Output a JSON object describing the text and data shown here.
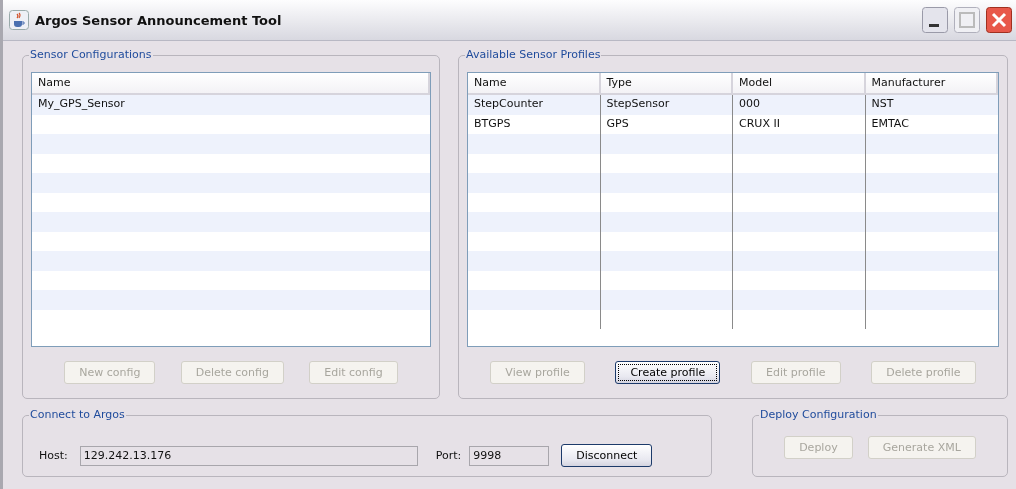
{
  "window": {
    "title": "Argos Sensor Announcement Tool"
  },
  "sensor_configurations": {
    "title": "Sensor Configurations",
    "table": {
      "columns": [
        "Name"
      ],
      "rows": [
        [
          "My_GPS_Sensor"
        ]
      ]
    },
    "buttons": [
      {
        "label": "New config",
        "disabled": true,
        "focused": false
      },
      {
        "label": "Delete config",
        "disabled": true,
        "focused": false
      },
      {
        "label": "Edit config",
        "disabled": true,
        "focused": false
      }
    ]
  },
  "available_sensor_profiles": {
    "title": "Available Sensor Profiles",
    "table": {
      "columns": [
        "Name",
        "Type",
        "Model",
        "Manufacturer"
      ],
      "rows": [
        [
          "StepCounter",
          "StepSensor",
          "000",
          "NST"
        ],
        [
          "BTGPS",
          "GPS",
          "CRUX II",
          "EMTAC"
        ]
      ]
    },
    "buttons": [
      {
        "label": "View profile",
        "disabled": true,
        "focused": false
      },
      {
        "label": "Create profile",
        "disabled": false,
        "focused": true
      },
      {
        "label": "Edit profile",
        "disabled": true,
        "focused": false
      },
      {
        "label": "Delete profile",
        "disabled": true,
        "focused": false
      }
    ]
  },
  "connect_to_argos": {
    "title": "Connect to Argos",
    "host_label": "Host:",
    "host": "129.242.13.176",
    "port_label": "Port:",
    "port": "9998",
    "button": {
      "label": "Disconnect",
      "disabled": false,
      "focused": false
    }
  },
  "deploy_configuration": {
    "title": "Deploy Configuration",
    "buttons": [
      {
        "label": "Deploy",
        "disabled": true,
        "focused": false
      },
      {
        "label": "Generate XML",
        "disabled": true,
        "focused": false
      }
    ]
  }
}
